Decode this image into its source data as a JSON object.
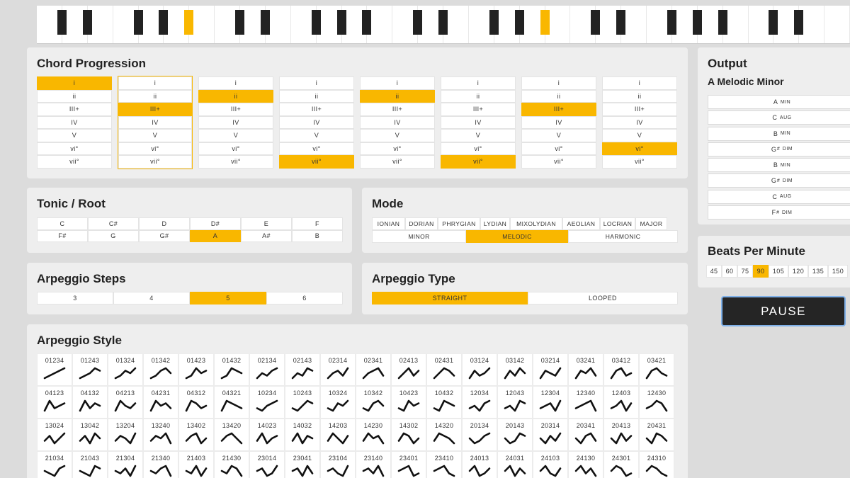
{
  "colors": {
    "accent": "#f9b700",
    "panel": "#eeeeee",
    "background": "#dcdcdc",
    "button": "#252525"
  },
  "keyboard": {
    "keys": 32,
    "highlighted_black": [
      5,
      19
    ],
    "highlighted_white": []
  },
  "chord_progression": {
    "title": "Chord Progression",
    "degrees": [
      "i",
      "ii",
      "III+",
      "IV",
      "V",
      "vi°",
      "vii°"
    ],
    "selected": [
      0,
      2,
      1,
      6,
      1,
      6,
      2,
      5
    ],
    "outlined_column": 1
  },
  "tonic": {
    "title": "Tonic / Root",
    "notes": [
      "C",
      "C#",
      "D",
      "D#",
      "E",
      "F",
      "F#",
      "G",
      "G#",
      "A",
      "A#",
      "B"
    ],
    "selected": "A"
  },
  "mode": {
    "title": "Mode",
    "row1": [
      "IONIAN",
      "DORIAN",
      "PHRYGIAN",
      "LYDIAN",
      "MIXOLYDIAN",
      "AEOLIAN",
      "LOCRIAN",
      "MAJOR"
    ],
    "row2": [
      "MINOR",
      "MELODIC",
      "HARMONIC"
    ],
    "selected": "MELODIC"
  },
  "arpeggio_steps": {
    "title": "Arpeggio Steps",
    "options": [
      "3",
      "4",
      "5",
      "6"
    ],
    "selected": "5"
  },
  "arpeggio_type": {
    "title": "Arpeggio Type",
    "options": [
      "STRAIGHT",
      "LOOPED"
    ],
    "selected": "STRAIGHT"
  },
  "arpeggio_style": {
    "title": "Arpeggio Style",
    "patterns": [
      "01234",
      "01243",
      "01324",
      "01342",
      "01423",
      "01432",
      "02134",
      "02143",
      "02314",
      "02341",
      "02413",
      "02431",
      "03124",
      "03142",
      "03214",
      "03241",
      "03412",
      "03421",
      "04123",
      "04132",
      "04213",
      "04231",
      "04312",
      "04321",
      "10234",
      "10243",
      "10324",
      "10342",
      "10423",
      "10432",
      "12034",
      "12043",
      "12304",
      "12340",
      "12403",
      "12430",
      "13024",
      "13042",
      "13204",
      "13240",
      "13402",
      "13420",
      "14023",
      "14032",
      "14203",
      "14230",
      "14302",
      "14320",
      "20134",
      "20143",
      "20314",
      "20341",
      "20413",
      "20431",
      "21034",
      "21043",
      "21304",
      "21340",
      "21403",
      "21430",
      "23014",
      "23041",
      "23104",
      "23140",
      "23401",
      "23410",
      "24013",
      "24031",
      "24103",
      "24130",
      "24301",
      "24310"
    ]
  },
  "output": {
    "title": "Output",
    "scale": "A Melodic Minor",
    "chords": [
      {
        "root": "A",
        "acc": "",
        "quality": "MIN"
      },
      {
        "root": "C",
        "acc": "",
        "quality": "AUG"
      },
      {
        "root": "B",
        "acc": "",
        "quality": "MIN"
      },
      {
        "root": "G",
        "acc": "#",
        "quality": "DIM"
      },
      {
        "root": "B",
        "acc": "",
        "quality": "MIN"
      },
      {
        "root": "G",
        "acc": "#",
        "quality": "DIM"
      },
      {
        "root": "C",
        "acc": "",
        "quality": "AUG"
      },
      {
        "root": "F",
        "acc": "#",
        "quality": "DIM"
      }
    ]
  },
  "bpm": {
    "title": "Beats Per Minute",
    "options": [
      "45",
      "60",
      "75",
      "90",
      "105",
      "120",
      "135",
      "150"
    ],
    "selected": "90"
  },
  "pause_button": {
    "label": "PAUSE"
  }
}
